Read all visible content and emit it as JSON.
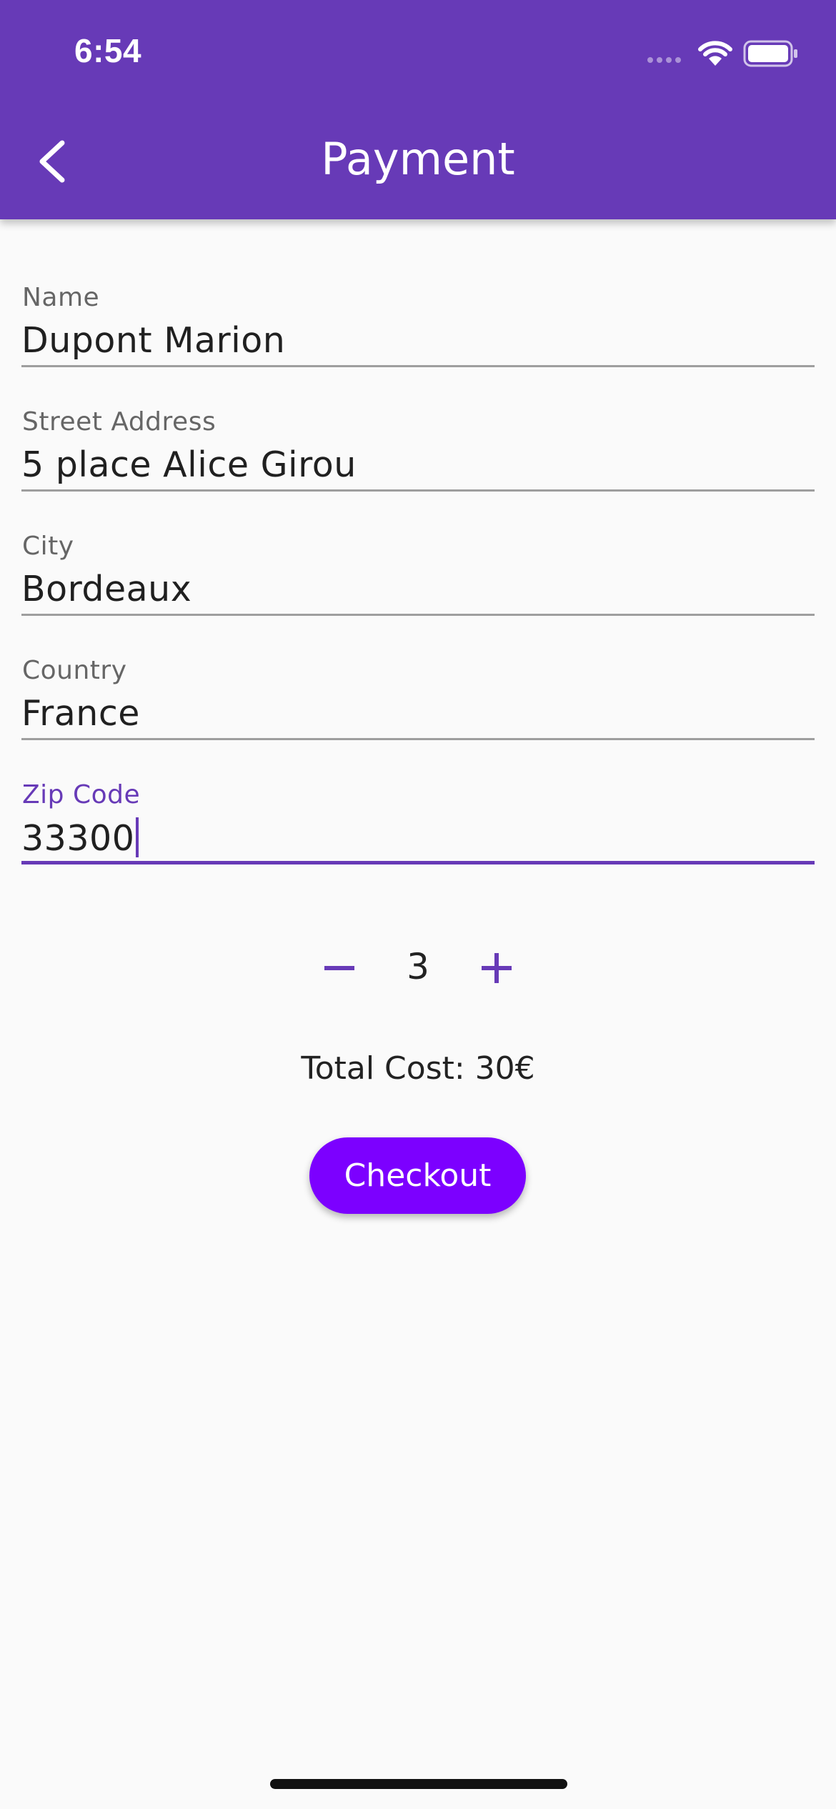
{
  "status_bar": {
    "time": "6:54"
  },
  "app_bar": {
    "title": "Payment",
    "back_icon": "chevron-left-icon"
  },
  "form": {
    "fields": [
      {
        "label": "Name",
        "value": "Dupont Marion"
      },
      {
        "label": "Street Address",
        "value": "5 place Alice Girou"
      },
      {
        "label": "City",
        "value": "Bordeaux"
      },
      {
        "label": "Country",
        "value": "France"
      },
      {
        "label": "Zip Code",
        "value": "33300"
      }
    ]
  },
  "quantity": {
    "value": "3",
    "minus_icon": "minus-icon",
    "plus_icon": "plus-icon"
  },
  "total": {
    "text": "Total Cost: 30€"
  },
  "checkout": {
    "label": "Checkout"
  },
  "colors": {
    "primary": "#673ab7",
    "button": "#7c00ff",
    "background": "#fafafa"
  }
}
